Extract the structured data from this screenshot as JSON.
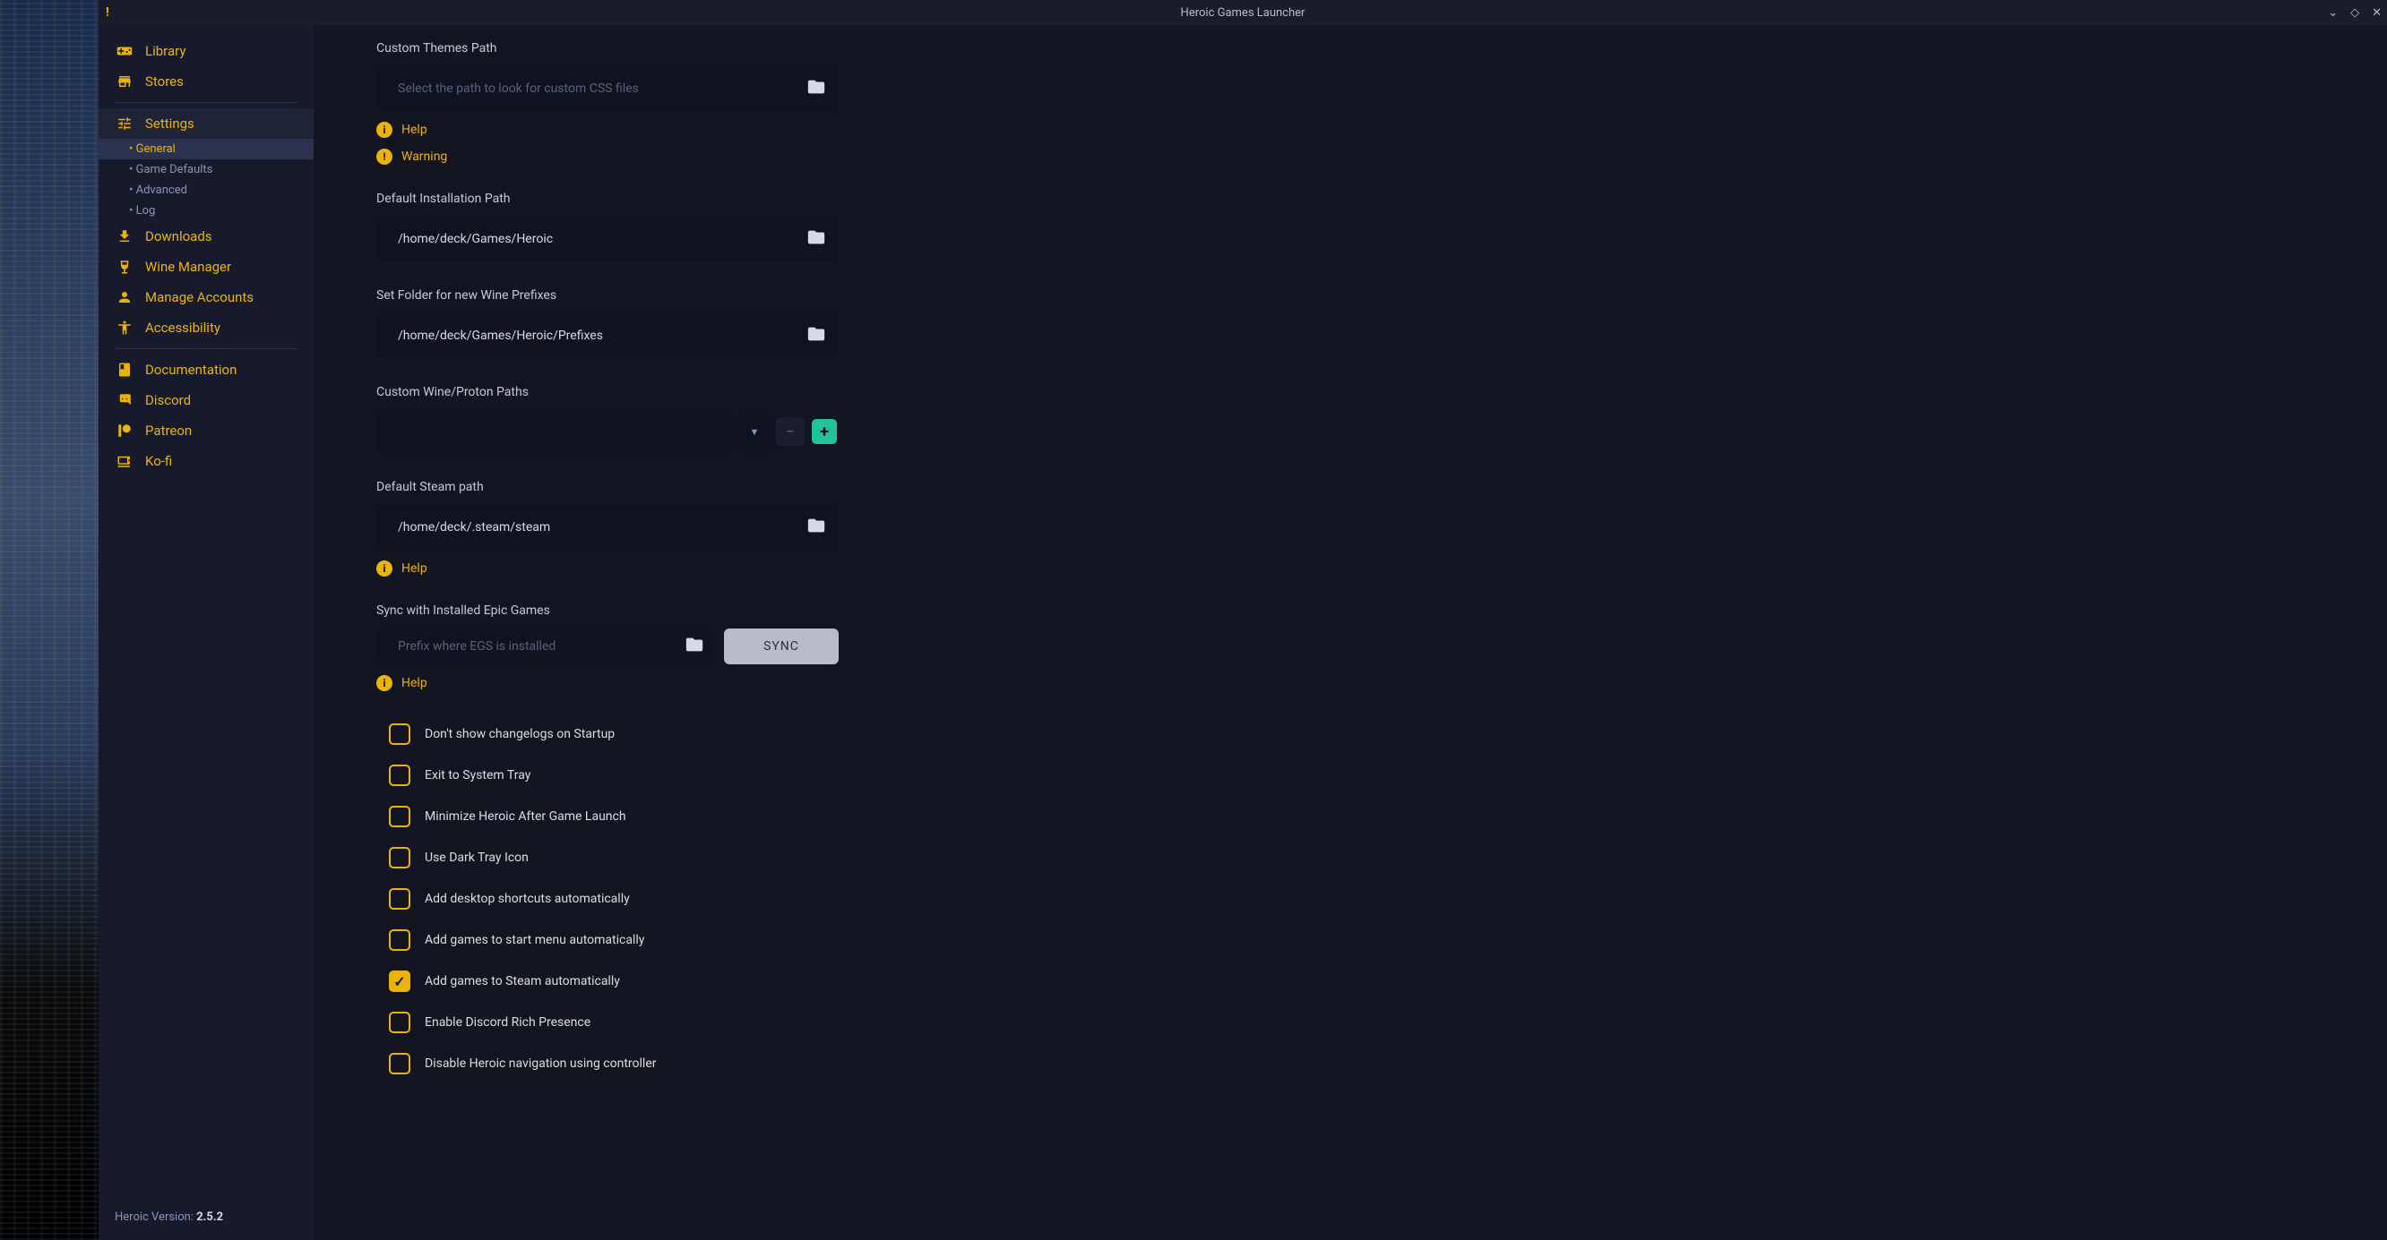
{
  "window": {
    "title": "Heroic Games Launcher"
  },
  "sidebar": {
    "items": [
      {
        "icon": "gamepad-icon",
        "label": "Library"
      },
      {
        "icon": "store-icon",
        "label": "Stores"
      },
      {
        "icon": "settings-icon",
        "label": "Settings"
      },
      {
        "icon": "download-icon",
        "label": "Downloads"
      },
      {
        "icon": "wine-icon",
        "label": "Wine Manager"
      },
      {
        "icon": "user-icon",
        "label": "Manage Accounts"
      },
      {
        "icon": "accessibility-icon",
        "label": "Accessibility"
      }
    ],
    "settings_sub": [
      {
        "label": "General",
        "active": true
      },
      {
        "label": "Game Defaults",
        "active": false
      },
      {
        "label": "Advanced",
        "active": false
      },
      {
        "label": "Log",
        "active": false
      }
    ],
    "links": [
      {
        "icon": "book-icon",
        "label": "Documentation"
      },
      {
        "icon": "discord-icon",
        "label": "Discord"
      },
      {
        "icon": "patreon-icon",
        "label": "Patreon"
      },
      {
        "icon": "kofi-icon",
        "label": "Ko-fi"
      }
    ],
    "version_label": "Heroic Version:",
    "version": "2.5.2"
  },
  "settings": {
    "custom_themes": {
      "label": "Custom Themes Path",
      "placeholder": "Select the path to look for custom CSS files",
      "value": "",
      "help": "Help",
      "warning": "Warning"
    },
    "default_install": {
      "label": "Default Installation Path",
      "value": "/home/deck/Games/Heroic"
    },
    "wine_prefixes": {
      "label": "Set Folder for new Wine Prefixes",
      "value": "/home/deck/Games/Heroic/Prefixes"
    },
    "custom_wine": {
      "label": "Custom Wine/Proton Paths",
      "value": ""
    },
    "steam_path": {
      "label": "Default Steam path",
      "value": "/home/deck/.steam/steam",
      "help": "Help"
    },
    "sync_egs": {
      "label": "Sync with Installed Epic Games",
      "placeholder": "Prefix where EGS is installed",
      "value": "",
      "button": "SYNC",
      "help": "Help"
    },
    "checkboxes": [
      {
        "label": "Don't show changelogs on Startup",
        "checked": false
      },
      {
        "label": "Exit to System Tray",
        "checked": false
      },
      {
        "label": "Minimize Heroic After Game Launch",
        "checked": false
      },
      {
        "label": "Use Dark Tray Icon",
        "checked": false
      },
      {
        "label": "Add desktop shortcuts automatically",
        "checked": false
      },
      {
        "label": "Add games to start menu automatically",
        "checked": false
      },
      {
        "label": "Add games to Steam automatically",
        "checked": true
      },
      {
        "label": "Enable Discord Rich Presence",
        "checked": false
      },
      {
        "label": "Disable Heroic navigation using controller",
        "checked": false
      }
    ]
  }
}
